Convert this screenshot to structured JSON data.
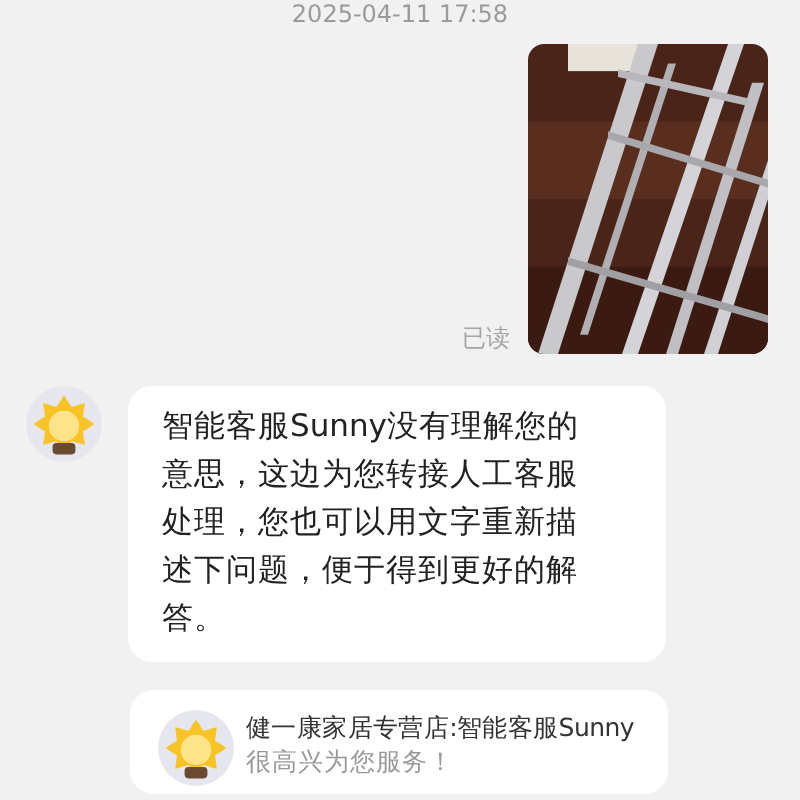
{
  "timestamp": "2025-04-11 17:58",
  "sent_message": {
    "kind": "picture",
    "read_receipt": "已读"
  },
  "bot_message": {
    "text": "智能客服Sunny没有理解您的意思，这边为您转接人工客服处理，您也可以用文字重新描述下问题，便于得到更好的解答。"
  },
  "welcome_card": {
    "title": "健一康家居专营店:智能客服Sunny",
    "subtitle": "很高兴为您服务！"
  }
}
